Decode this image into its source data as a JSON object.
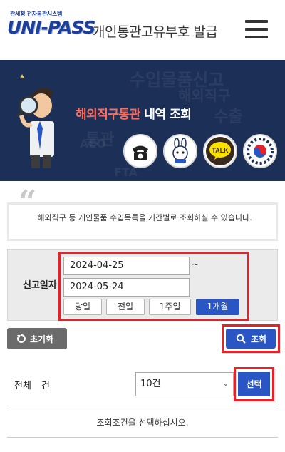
{
  "header": {
    "logo_subtitle": "관세청 전자통관시스템",
    "logo_text": "UNI-PASS",
    "title": "개인통관고유부호 발급"
  },
  "banner": {
    "heading_highlight": "해외직구통관",
    "heading_rest": " 내역 조회",
    "bg_texts": [
      "수입물품신고",
      "해외직구",
      "통관",
      "수출",
      "AEO",
      "FTA"
    ],
    "talk_label": "TALK"
  },
  "description": {
    "quote_mark": "“",
    "text": "해외직구 등 개인물품 수입목록을 기간별로 조회하실 수 있습니다."
  },
  "search": {
    "date_label": "신고일자",
    "date_from": "2024-04-25",
    "date_to": "2024-05-24",
    "tilde": "~",
    "periods": [
      "당일",
      "전일",
      "1주일",
      "1개월"
    ],
    "active_period": "1개월",
    "reset_label": "초기화",
    "search_label": "조회"
  },
  "results": {
    "total_label": "전체 건",
    "page_size": "10건",
    "choose_label": "선택",
    "empty_message": "조회조건을 선택하십시오."
  },
  "colors": {
    "banner_bg": "#1c2f57",
    "highlight": "#ff6b5a",
    "primary": "#2a55c4",
    "annotation_red": "#e8202a"
  }
}
